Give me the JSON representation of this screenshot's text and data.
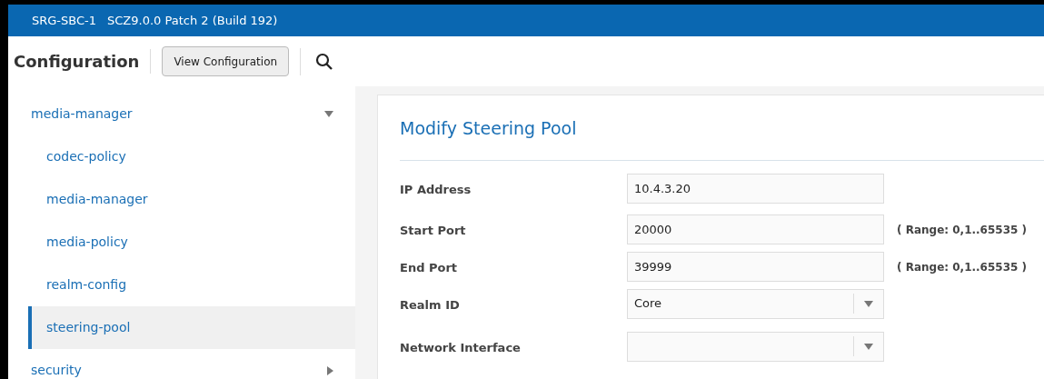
{
  "header": {
    "device": "SRG-SBC-1",
    "version": "SCZ9.0.0 Patch 2 (Build 192)"
  },
  "toolbar": {
    "title": "Configuration",
    "button": "View Configuration"
  },
  "sidebar": {
    "items": [
      {
        "label": "media-manager",
        "expanded": true,
        "selected": false,
        "children": [
          {
            "label": "codec-policy",
            "selected": false
          },
          {
            "label": "media-manager",
            "selected": false
          },
          {
            "label": "media-policy",
            "selected": false
          },
          {
            "label": "realm-config",
            "selected": false
          },
          {
            "label": "steering-pool",
            "selected": true
          }
        ]
      },
      {
        "label": "security",
        "expanded": false,
        "selected": false
      }
    ]
  },
  "form": {
    "title": "Modify Steering Pool",
    "fields": [
      {
        "kind": "text",
        "label": "IP Address",
        "value": "10.4.3.20"
      },
      {
        "kind": "text",
        "label": "Start Port",
        "value": "20000",
        "hint": "( Range: 0,1..65535 )"
      },
      {
        "kind": "text",
        "label": "End Port",
        "value": "39999",
        "hint": "( Range: 0,1..65535 )"
      },
      {
        "kind": "select",
        "label": "Realm ID",
        "value": "Core"
      },
      {
        "kind": "select",
        "label": "Network Interface"
      }
    ]
  }
}
